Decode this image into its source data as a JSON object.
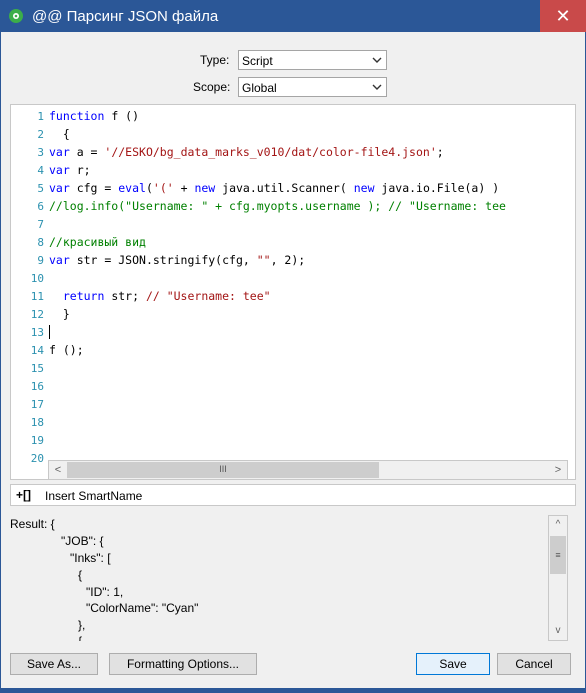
{
  "window": {
    "title": "@@ Парсинг JSON файла",
    "close_glyph": "✕"
  },
  "form": {
    "type_label": "Type:",
    "type_value": "Script",
    "scope_label": "Scope:",
    "scope_value": "Global"
  },
  "editor": {
    "line_numbers": [
      "1",
      "2",
      "3",
      "4",
      "5",
      "6",
      "7",
      "8",
      "9",
      "10",
      "11",
      "12",
      "13",
      "14",
      "15",
      "16",
      "17",
      "18",
      "19",
      "20"
    ],
    "code": {
      "l1_kw": "function",
      "l1_rest": " f ()",
      "l2": "  {",
      "l3_kw": "var",
      "l3_rest": " a = ",
      "l3_str": "'//ESKO/bg_data_marks_v010/dat/color-file4.json'",
      "l3_end": ";",
      "l4_kw": "var",
      "l4_rest": " r;",
      "l5_kw": "var",
      "l5_rest": " cfg = ",
      "l5_fn": "eval",
      "l5_rest2": "(",
      "l5_str": "'('",
      "l5_rest3": " + ",
      "l5_kw2": "new",
      "l5_rest4": " java.util.Scanner( ",
      "l5_kw3": "new",
      "l5_rest5": " java.io.File(a) )",
      "l6": "//log.info(\"Username: \" + cfg.myopts.username ); // \"Username: tee",
      "l8": "//красивый вид",
      "l9_kw": "var",
      "l9_rest": " str = JSON.stringify(cfg, ",
      "l9_str": "\"\"",
      "l9_end": ", 2);",
      "l11_kw": "  return",
      "l11_rest": " str; ",
      "l11_cm": "// \"Username: tee\"",
      "l12": "  }",
      "l14": "f ();"
    }
  },
  "hscroll": {
    "left": "<",
    "right": ">",
    "grip": "III"
  },
  "smartname": {
    "plus": "+",
    "bracket": "[]",
    "label": "Insert SmartName"
  },
  "result": {
    "lines": [
      "Result: {",
      "\"JOB\": {",
      "\"Inks\": [",
      "{",
      "\"ID\": 1,",
      "\"ColorName\": \"Cyan\"",
      "},",
      "{"
    ]
  },
  "vscroll": {
    "up": "^",
    "down": "v",
    "grip": "≡"
  },
  "buttons": {
    "save_as": "Save As...",
    "formatting": "Formatting Options...",
    "save": "Save",
    "cancel": "Cancel"
  },
  "colors": {
    "title_bar": "#2b5797",
    "close": "#c94a4a",
    "keyword": "#0000ff",
    "string": "#a31515",
    "comment": "#008000",
    "line_number": "#2b91af"
  }
}
